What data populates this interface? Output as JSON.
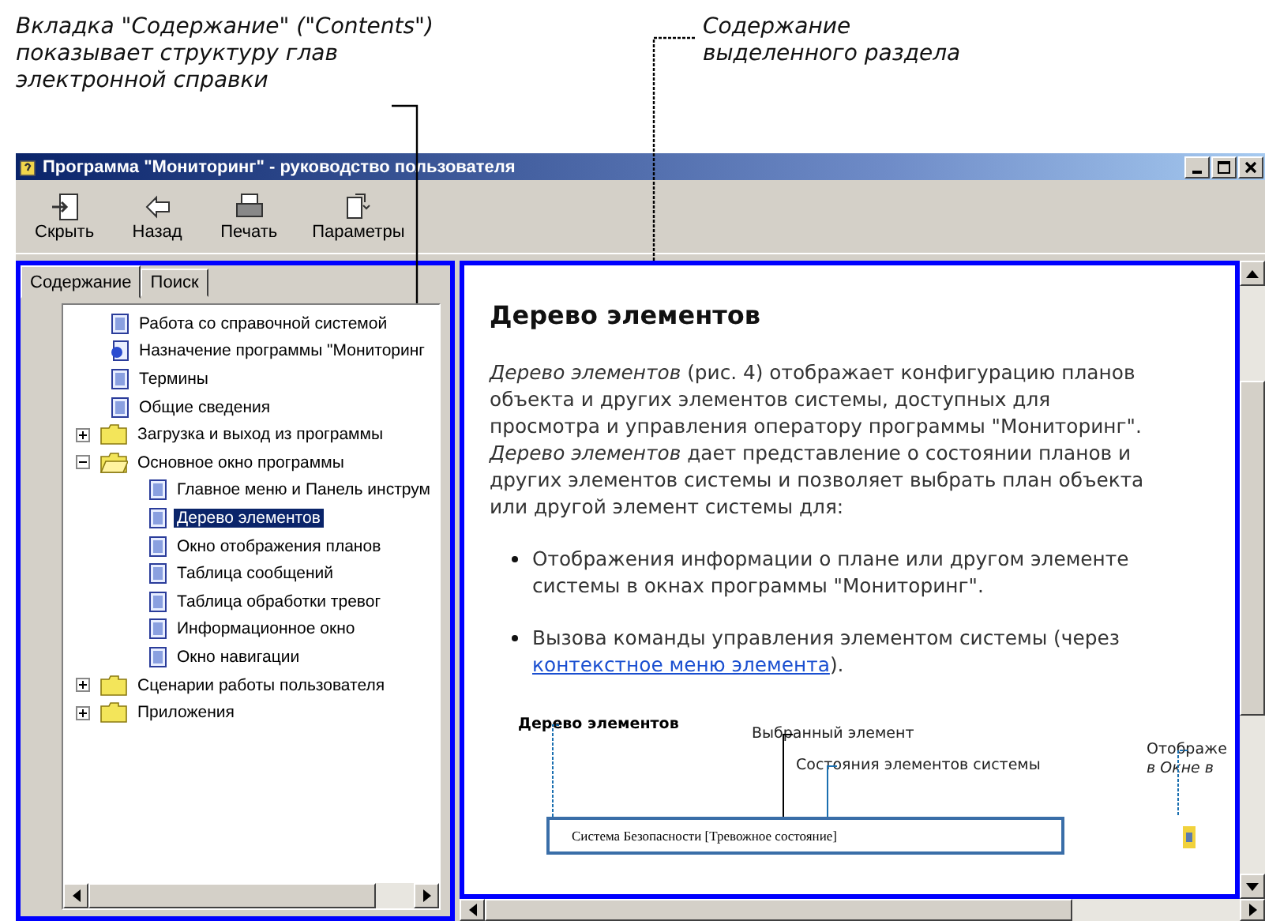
{
  "annotations": [
    {
      "text": "Вкладка \"Содержание\" (\"Contents\") показывает структуру глав электронной справки"
    },
    {
      "text": "Содержание выделенного раздела"
    }
  ],
  "window": {
    "title": "Программа \"Мониторинг\" - руководство пользователя"
  },
  "toolbar": [
    {
      "label": "Скрыть",
      "kind": "hide"
    },
    {
      "label": "Назад",
      "kind": "back"
    },
    {
      "label": "Печать",
      "kind": "print"
    },
    {
      "label": "Параметры",
      "kind": "options"
    }
  ],
  "tabs": [
    {
      "label": "Содержание",
      "selected": true
    },
    {
      "label": "Поиск",
      "selected": false
    }
  ],
  "tree": {
    "items": [
      {
        "label": "Работа со справочной системой",
        "kind": "page",
        "selected": false
      },
      {
        "label": "Назначение программы \"Мониторинг",
        "kind": "web-page",
        "selected": false
      },
      {
        "label": "Термины",
        "kind": "page",
        "selected": false
      },
      {
        "label": "Общие сведения",
        "kind": "page",
        "selected": false
      },
      {
        "label": "Загрузка и выход из программы",
        "kind": "folder",
        "expanded": false,
        "selected": false
      },
      {
        "label": "Основное окно программы",
        "kind": "folder",
        "expanded": true,
        "selected": false,
        "children": [
          {
            "label": "Главное меню и Панель инструм",
            "kind": "page",
            "selected": false
          },
          {
            "label": "Дерево элементов",
            "kind": "page",
            "selected": true
          },
          {
            "label": "Окно отображения планов",
            "kind": "page",
            "selected": false
          },
          {
            "label": "Таблица сообщений",
            "kind": "page",
            "selected": false
          },
          {
            "label": "Таблица обработки тревог",
            "kind": "page",
            "selected": false
          },
          {
            "label": "Информационное окно",
            "kind": "page",
            "selected": false
          },
          {
            "label": "Окно навигации",
            "kind": "page",
            "selected": false
          }
        ]
      },
      {
        "label": "Сценарии работы пользователя",
        "kind": "folder",
        "expanded": false,
        "selected": false
      },
      {
        "label": "Приложения",
        "kind": "folder",
        "expanded": false,
        "selected": false
      }
    ]
  },
  "content": {
    "heading": "Дерево элементов",
    "paragraph": "*Дерево элементов* (рис. 4) отображает конфигурацию планов объекта и других элементов системы, доступных для просмотра и управления оператору программы \"Мониторинг\". *Дерево элементов* дает представление о состоянии планов и других элементов системы и позволяет выбрать план объекта или другой элемент системы для:",
    "bullets": [
      {
        "text": "Отображения информации о плане или другом элементе системы в окнах программы \"Мониторинг\"."
      },
      {
        "text": "Вызова команды управления элементом системы (через ",
        "link": "контекстное меню элемента",
        "after": ")."
      }
    ],
    "figure": {
      "labels": [
        {
          "text": "Дерево элементов",
          "kind": "bold"
        },
        {
          "text": "Выбранный элемент",
          "kind": "plain"
        },
        {
          "text": "Состояния элементов системы",
          "kind": "plain"
        },
        {
          "text": "Отображе",
          "kind": "plain"
        },
        {
          "text": "в Окне в",
          "kind": "italic"
        }
      ],
      "window_title": "Система Безопасности [Тревожное состояние]"
    }
  }
}
